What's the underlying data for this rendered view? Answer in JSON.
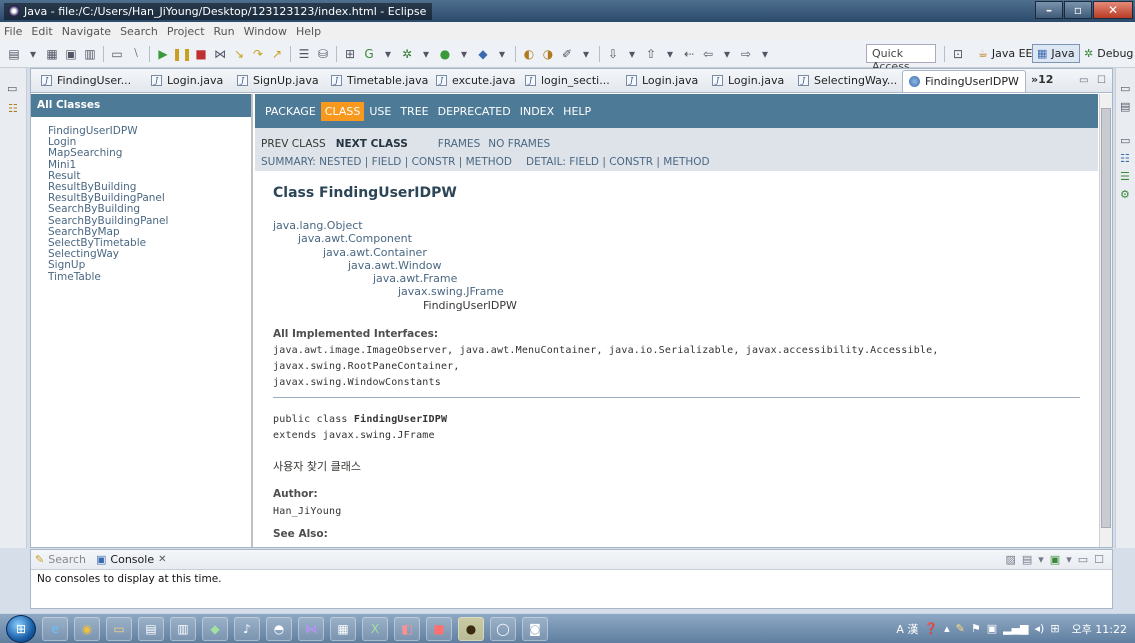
{
  "window": {
    "title": "Java - file:/C:/Users/Han_JiYoung/Desktop/123123123/index.html - Eclipse",
    "minimize": "–",
    "maximize": "▫",
    "close": "✕"
  },
  "menu": [
    "File",
    "Edit",
    "Navigate",
    "Search",
    "Project",
    "Run",
    "Window",
    "Help"
  ],
  "toolbar": {
    "quick_access": "Quick Access",
    "perspectives": [
      {
        "label": "Java EE"
      },
      {
        "label": "Java"
      },
      {
        "label": "Debug"
      }
    ]
  },
  "editor_tabs": [
    "FindingUser...",
    "Login.java",
    "SignUp.java",
    "Timetable.java",
    "excute.java",
    "login_secti...",
    "Login.java",
    "Login.java",
    "SelectingWay..."
  ],
  "active_tab": "FindingUserIDPW",
  "active_tab_close": "✕",
  "tab_overflow": "»12",
  "javadoc": {
    "all_classes_header": "All Classes",
    "classes": [
      "FindingUserIDPW",
      "Login",
      "MapSearching",
      "Mini1",
      "Result",
      "ResultByBuilding",
      "ResultByBuildingPanel",
      "SearchByBuilding",
      "SearchByBuildingPanel",
      "SearchByMap",
      "SelectByTimetable",
      "SelectingWay",
      "SignUp",
      "TimeTable"
    ],
    "nav": [
      "PACKAGE",
      "CLASS",
      "USE",
      "TREE",
      "DEPRECATED",
      "INDEX",
      "HELP"
    ],
    "nav_active": "CLASS",
    "subnav": {
      "prev": "PREV CLASS",
      "next": "NEXT CLASS",
      "frames": "FRAMES",
      "no_frames": "NO FRAMES",
      "summary": "SUMMARY: NESTED | FIELD | CONSTR | METHOD",
      "detail": "DETAIL: FIELD | CONSTR | METHOD"
    },
    "class_title": "Class FindingUserIDPW",
    "inheritance": [
      "java.lang.Object",
      "java.awt.Component",
      "java.awt.Container",
      "java.awt.Window",
      "java.awt.Frame",
      "javax.swing.JFrame",
      "FindingUserIDPW"
    ],
    "interfaces_label": "All Implemented Interfaces:",
    "interfaces_line1": "java.awt.image.ImageObserver, java.awt.MenuContainer, java.io.Serializable, javax.accessibility.Accessible, javax.swing.RootPaneContainer,",
    "interfaces_line2": "javax.swing.WindowConstants",
    "decl_prefix": "public class ",
    "decl_name": "FindingUserIDPW",
    "extends": "extends javax.swing.JFrame",
    "description": "사용자 찾기 클래스",
    "author_label": "Author:",
    "author": "Han_JiYoung",
    "see_also_label": "See Also:"
  },
  "console": {
    "search_tab": "Search",
    "console_tab": "Console",
    "console_close": "✕",
    "message": "No consoles to display at this time."
  },
  "taskbar": {
    "ime": "A 漢",
    "clock": "오후 11:22"
  },
  "colors": {
    "javadoc_nav": "#4d7a97",
    "javadoc_active": "#f8981d",
    "javadoc_subnav": "#dee3e9"
  }
}
